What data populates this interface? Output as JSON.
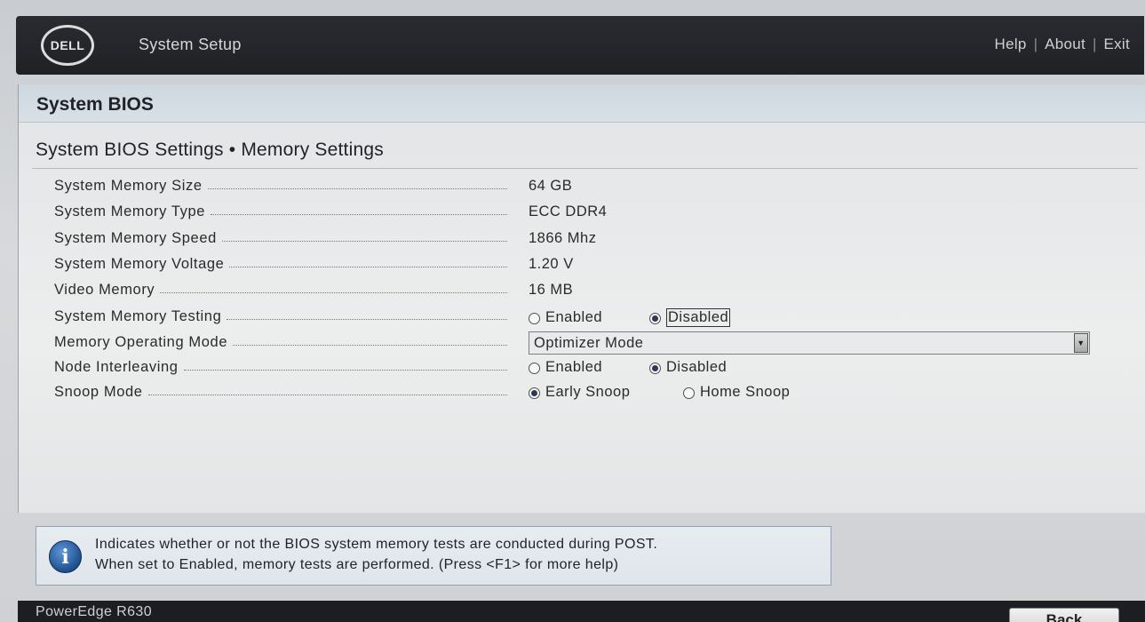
{
  "header": {
    "logo_text": "DELL",
    "app_title": "System Setup",
    "links": [
      "Help",
      "About",
      "Exit"
    ]
  },
  "panel": {
    "title": "System BIOS",
    "breadcrumb": "System BIOS Settings • Memory Settings"
  },
  "settings": [
    {
      "label": "System Memory Size",
      "value": "64 GB"
    },
    {
      "label": "System Memory Type",
      "value": "ECC DDR4"
    },
    {
      "label": "System Memory Speed",
      "value": "1866 Mhz"
    },
    {
      "label": "System Memory Voltage",
      "value": "1.20 V"
    },
    {
      "label": "Video Memory",
      "value": "16 MB"
    },
    {
      "label": "System Memory Testing",
      "options": [
        "Enabled",
        "Disabled"
      ],
      "selected": "Disabled"
    },
    {
      "label": "Memory Operating Mode",
      "value": "Optimizer Mode"
    },
    {
      "label": "Node Interleaving",
      "options": [
        "Enabled",
        "Disabled"
      ],
      "selected": "Disabled"
    },
    {
      "label": "Snoop Mode",
      "options": [
        "Early Snoop",
        "Home Snoop"
      ],
      "selected": "Early Snoop"
    }
  ],
  "info": {
    "icon": "info-icon",
    "line1": "Indicates whether or not the BIOS system memory tests are conducted during POST.",
    "line2": "When set to Enabled, memory tests are performed. (Press <F1> for more help)"
  },
  "footer": {
    "model": "PowerEdge R630",
    "back_label": "Back"
  }
}
